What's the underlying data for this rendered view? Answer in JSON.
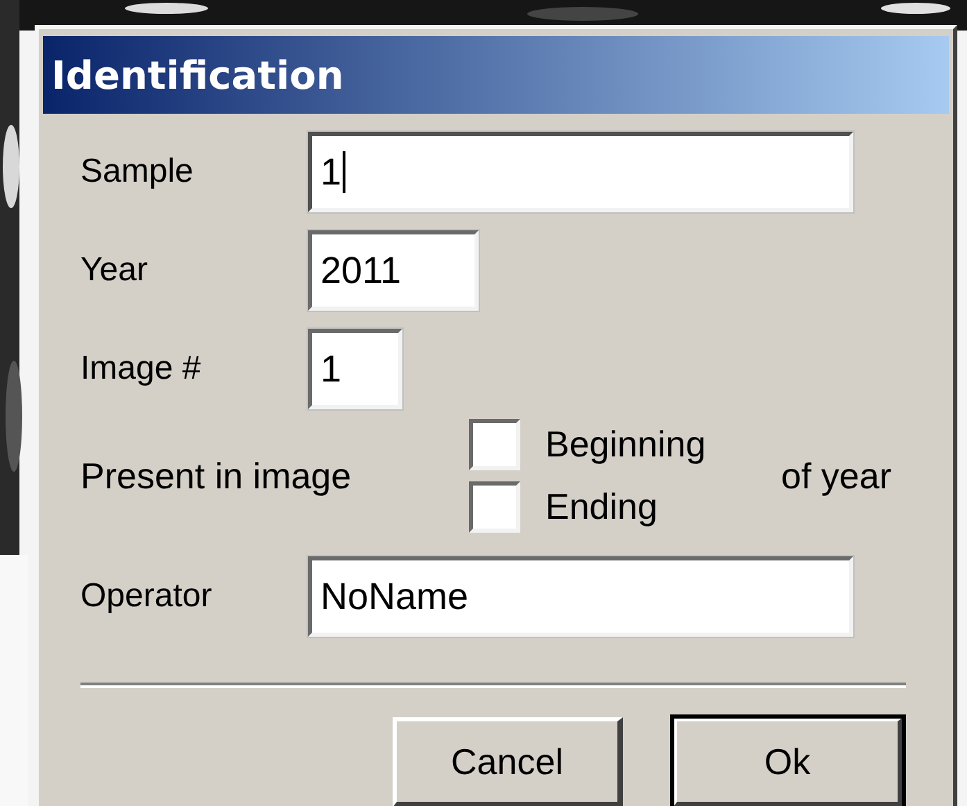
{
  "window": {
    "title": "Identification"
  },
  "fields": [
    {
      "label": "Sample",
      "value": "1",
      "focused": true
    },
    {
      "label": "Year",
      "value": "2011",
      "focused": false
    },
    {
      "label": "Image #",
      "value": "1",
      "focused": false
    }
  ],
  "presence": {
    "label": "Present in image",
    "options": [
      {
        "label": "Beginning",
        "checked": false
      },
      {
        "label": "Ending",
        "checked": false
      }
    ],
    "suffix": "of year"
  },
  "operator": {
    "label": "Operator",
    "value": "NoName",
    "focused": false
  },
  "buttons": [
    {
      "label": "Cancel",
      "default": false
    },
    {
      "label": "Ok",
      "default": true
    }
  ]
}
